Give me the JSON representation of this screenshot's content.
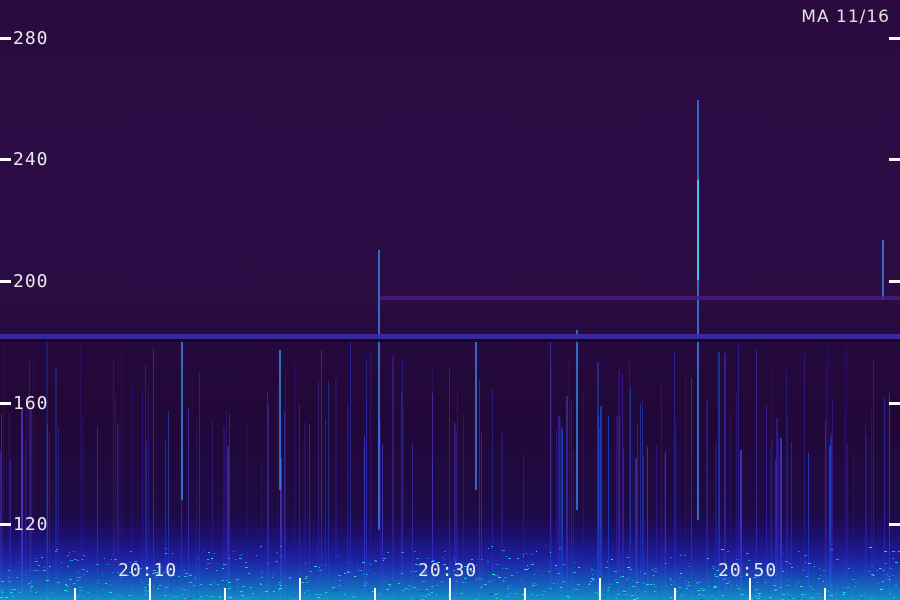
{
  "station_label": "MA 11/16",
  "y_axis": {
    "ticks": [
      {
        "value": 280,
        "label": "280"
      },
      {
        "value": 240,
        "label": "240"
      },
      {
        "value": 200,
        "label": "200"
      },
      {
        "value": 160,
        "label": "160"
      },
      {
        "value": 120,
        "label": "120"
      }
    ]
  },
  "x_axis": {
    "labels": [
      "20:10",
      "20:30",
      "20:50"
    ]
  },
  "colors": {
    "background": "#2a0b40",
    "horizontal_band": "#3a2a9a",
    "noise_low": "#1030c0",
    "noise_high": "#20e0d0",
    "tick": "#ffffff"
  }
}
